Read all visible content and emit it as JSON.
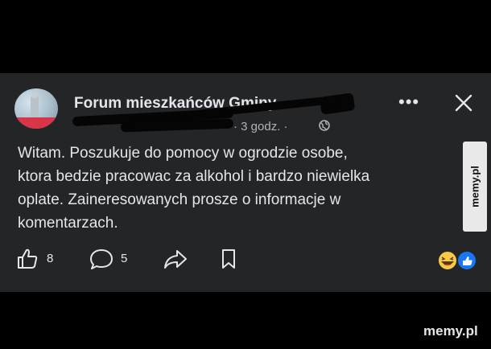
{
  "post": {
    "group_name": "Forum mieszkańców Gminy",
    "time_ago": "· 3 godz. ·",
    "privacy_icon": "globe-icon",
    "body_lines": [
      "Witam. Poszukuje do pomocy w ogrodzie osobe,",
      "ktora bedzie pracowac za alkohol i bardzo niewielka",
      "oplate. Zaineresowanych prosze o informacje w",
      "komentarzach."
    ]
  },
  "header_actions": {
    "more_icon": "more-dots-icon",
    "close_icon": "close-icon"
  },
  "actions": {
    "like_count": "8",
    "comment_count": "5",
    "like_icon": "thumbs-up-icon",
    "comment_icon": "comment-icon",
    "share_icon": "share-icon",
    "save_icon": "bookmark-icon"
  },
  "reactions": [
    "laughing-emoji-icon",
    "like-reaction-icon"
  ],
  "watermark": {
    "side": "memy.pl",
    "bottom": "memy.pl"
  },
  "colors": {
    "background": "#000000",
    "card": "#242526",
    "text": "#e4e6eb",
    "secondary": "#b0b3b8",
    "like_blue": "#1877f2"
  }
}
